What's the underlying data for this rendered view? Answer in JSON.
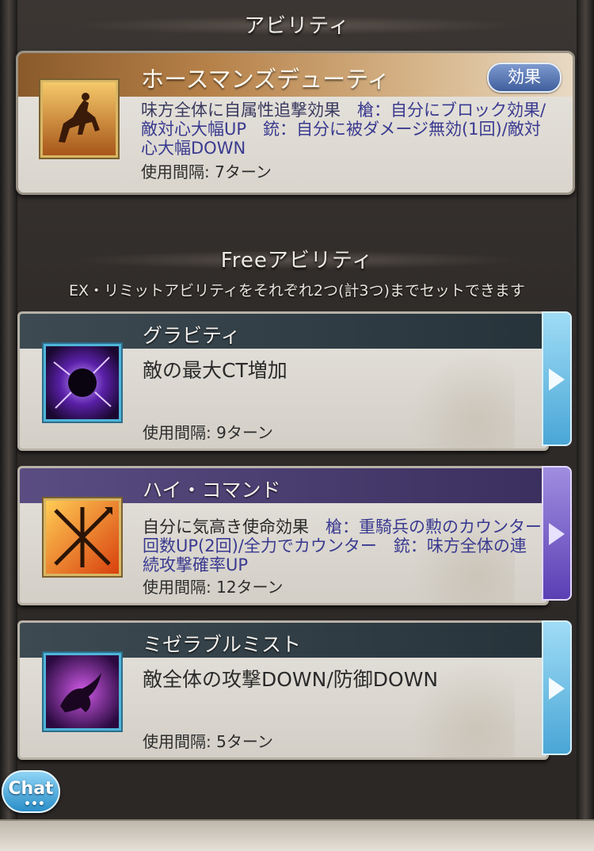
{
  "section_title": "アビリティ",
  "main_ability": {
    "name": "ホースマンズデューティ",
    "effect_button": "効果",
    "desc_plain": "味方全体に自属性追撃効果　",
    "desc_hl": "槍：自分にブロック効果/敵対心大幅UP　銃：自分に被ダメージ無効(1回)/敵対心大幅DOWN",
    "interval": "使用間隔: 7ターン",
    "icon": "horseman-icon"
  },
  "free_section": {
    "title": "Freeアビリティ",
    "note": "EX・リミットアビリティをそれぞれ2つ(計3つ)までセットできます"
  },
  "free_abilities": [
    {
      "name": "グラビティ",
      "desc": "敵の最大CT増加",
      "interval": "使用間隔: 9ターン",
      "icon": "gravity-icon"
    },
    {
      "name": "ハイ・コマンド",
      "desc_plain": "自分に気高き使命効果　",
      "desc_hl": "槍：重騎兵の勲のカウンター回数UP(2回)/全力でカウンター　銃：味方全体の連続攻撃確率UP",
      "interval": "使用間隔: 12ターン",
      "icon": "high-command-icon"
    },
    {
      "name": "ミゼラブルミスト",
      "desc": "敵全体の攻撃DOWN/防御DOWN",
      "interval": "使用間隔: 5ターン",
      "icon": "miserable-mist-icon"
    }
  ],
  "chat_label": "Chat",
  "chat_dots": "•••",
  "colors": {
    "accent_blue": "#4aa6d6",
    "accent_purple": "#5a3fb4",
    "header_brown": "#8a5a2a"
  }
}
